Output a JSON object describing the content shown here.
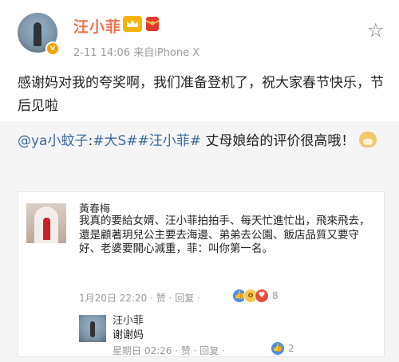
{
  "header": {
    "username": "汪小菲",
    "meta": "2-11 14:06  来自iPhone X",
    "verified_badge": "v",
    "icons": [
      "avatar",
      "crown-icon",
      "red-envelope-icon",
      "star-icon"
    ]
  },
  "post": {
    "text": "感谢妈对我的夸奖啊，我们准备登机了，祝大家春节快乐，节后见啦"
  },
  "repost": {
    "mention": "@ya小蚊子",
    "colon": ":",
    "topic1": "#大S#",
    "topic2": "#汪小菲#",
    "text": " 丈母娘给的评价很高哦！",
    "comment": {
      "name": "黃春梅",
      "body": "我真的要給女婿、汪小菲拍拍手、每天忙進忙出，飛來飛去，還是顧著玥兒公主要去海邊、弟弟去公園、飯店品質又要守好、老婆要開心減重，菲：叫你第一名。",
      "meta": "1月20日 22:20 · 赞 · 回复 ·",
      "reaction_count": "8",
      "reply": {
        "name": "汪小菲",
        "text": "谢谢妈",
        "meta": "星期日 02:26 · 赞 · 回复 ·",
        "reaction_count": "2"
      }
    }
  },
  "colors": {
    "username": "#eb7350",
    "link": "#3a6a9e",
    "repost_bg": "#f5f5f5",
    "like": "#4a90e2"
  }
}
